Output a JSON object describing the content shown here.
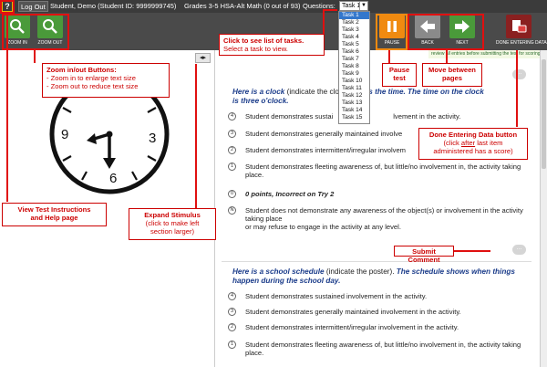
{
  "topbar": {
    "help_glyph": "?",
    "logout_label": "Log Out",
    "student": "Student, Demo (Student ID: 9999999745)",
    "grade_test": "Grades 3-5 HSA-Alt Math (0 out of 93)",
    "questions_label": "Questions:",
    "question_selected": "Task 1"
  },
  "toolbar": {
    "zoom_in": "ZOOM IN",
    "zoom_out": "ZOOM OUT",
    "pause": "PAUSE",
    "back": "BACK",
    "next": "NEXT",
    "done": "DONE ENTERING DATA"
  },
  "task_list": [
    "Task 1",
    "Task 2",
    "Task 3",
    "Task 4",
    "Task 5",
    "Task 6",
    "Task 7",
    "Task 8",
    "Task 9",
    "Task 10",
    "Task 11",
    "Task 12",
    "Task 13",
    "Task 14",
    "Task 15"
  ],
  "notice": "review all entries before submitting the test for scoring.",
  "clock_numbers": {
    "n9": "9",
    "n3": "3",
    "n6": "6"
  },
  "item1": {
    "prompt_a": "Here is a clock",
    "prompt_b": " (indicate the clo",
    "prompt_c": "ck shows the time. The time on the clock",
    "prompt_d": "is three o'clock.",
    "options": [
      {
        "badge": "4",
        "text": "Student demonstrates sustai"
      },
      {
        "badge": "3",
        "text": "Student demonstrates generally maintained involve"
      },
      {
        "badge": "2",
        "text": "Student demonstrates intermittent/irregular involvem"
      },
      {
        "badge": "1",
        "text": "Student demonstrates fleeting awareness of, but little/no involvement in, the activity taking place."
      },
      {
        "badge": "0",
        "text": "0 points, Incorrect on Try 2"
      },
      {
        "badge": "N",
        "text": "Student does not demonstrate any awareness of the object(s) or involvement in the activity taking place"
      },
      {
        "badge": "",
        "text": "or may refuse to engage in the activity at any level."
      }
    ],
    "option1_tail": "lvement in the activity."
  },
  "item2": {
    "prompt_a": "Here is a school schedule",
    "prompt_b": " (indicate the poster). ",
    "prompt_c": "The schedule shows when things happen during the school day.",
    "options": [
      {
        "badge": "4",
        "text": "Student demonstrates sustained involvement in the activity."
      },
      {
        "badge": "3",
        "text": "Student demonstrates generally maintained involvement in the activity."
      },
      {
        "badge": "2",
        "text": "Student demonstrates intermittent/irregular involvement in the activity."
      },
      {
        "badge": "1",
        "text": "Student demonstrates fleeting awareness of, but little/no involvement in, the activity taking place."
      }
    ]
  },
  "comment_glyph": "...",
  "annotations": {
    "zoom_title": "Zoom in/out Buttons:",
    "zoom_line1": "- Zoom in to enlarge text size",
    "zoom_line2": "- Zoom out to reduce text size",
    "tasks_title": "Click to see list of tasks.",
    "tasks_line": "Select a task to view.",
    "pause_line1": "Pause",
    "pause_line2": "test",
    "move_line1": "Move between",
    "move_line2": "pages",
    "done_title": "Done Entering Data button",
    "done_line1a": "(click ",
    "done_line1b": "after",
    "done_line1c": " last item",
    "done_line2": "administered has a score)",
    "expand_title": "Expand Stimulus",
    "expand_line1": "(click to make left",
    "expand_line2": "section larger)",
    "help_line1": "View Test Instructions",
    "help_line2": "and Help page",
    "submit_comment": "Submit Comment"
  },
  "colors": {
    "annotation_red": "#e01010",
    "prompt_blue": "#1b3c8a",
    "zoom_green": "#4a9a3a",
    "pause_orange": "#f08a10"
  }
}
